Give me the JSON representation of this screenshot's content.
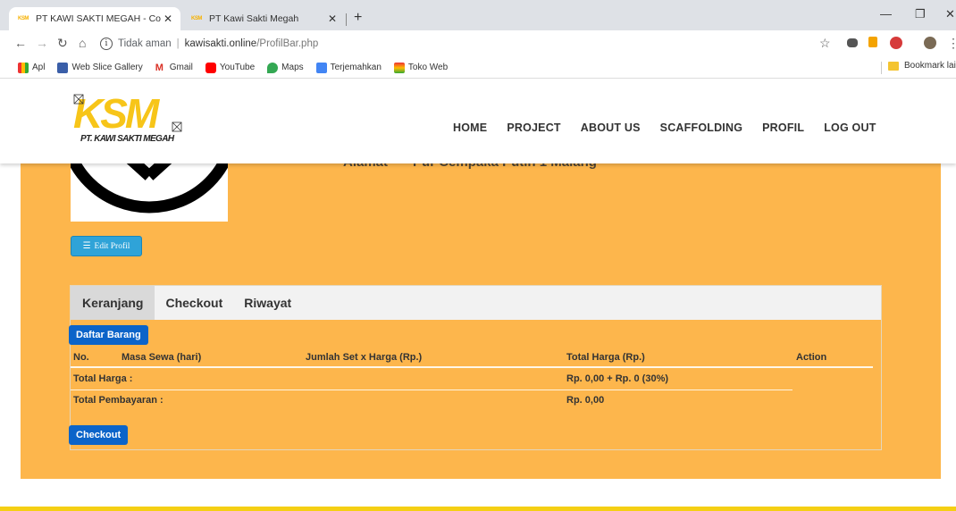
{
  "browser": {
    "tabs": [
      {
        "favicon": "KSM",
        "title": "PT KAWI SAKTI MEGAH - Constr",
        "active": true
      },
      {
        "favicon": "KSM",
        "title": "PT Kawi Sakti Megah",
        "active": false
      }
    ],
    "new_tab": "+",
    "address": {
      "security": "Tidak aman",
      "domain": "kawisakti.online",
      "path": "/ProfilBar.php"
    },
    "bookmarks": [
      "Apl",
      "Web Slice Gallery",
      "Gmail",
      "YouTube",
      "Maps",
      "Terjemahkan",
      "Toko Web"
    ],
    "bookmarks_right": "Bookmark lain"
  },
  "site": {
    "logo_text": "KSM",
    "logo_subtitle": "PT. KAWI SAKTI MEGAH",
    "nav": [
      "HOME",
      "PROJECT",
      "ABOUT US",
      "SCAFFOLDING",
      "PROFIL",
      "LOG OUT"
    ],
    "profile_field_label": "Alamat",
    "profile_field_value": "Pur Cempaka Putih 1 Malang",
    "edit_button": "Edit Profil",
    "tabs": [
      "Keranjang",
      "Checkout",
      "Riwayat"
    ],
    "daftar_button": "Daftar Barang",
    "table_headers": [
      "No.",
      "Masa Sewa (hari)",
      "Jumlah Set x Harga (Rp.)",
      "Total Harga (Rp.)",
      "Action"
    ],
    "total_harga_label": "Total Harga :",
    "total_harga_value": "Rp. 0,00 + Rp. 0 (30%)",
    "total_bayar_label": "Total Pembayaran :",
    "total_bayar_value": "Rp. 0,00",
    "checkout_button": "Checkout"
  },
  "colors": {
    "accent_orange": "#fdb64c",
    "button_blue": "#0b64c9",
    "edit_blue": "#2fa3d8",
    "footer_yellow": "#f5cf13"
  }
}
